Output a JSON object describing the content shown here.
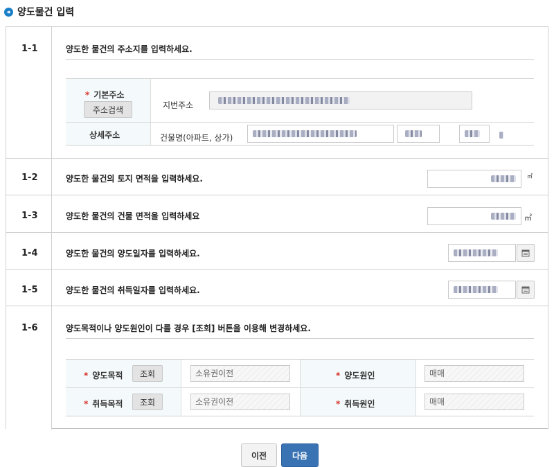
{
  "header": {
    "title": "양도물건 입력",
    "icon": "arrow-circle-icon",
    "accent": "#1a7fc7"
  },
  "sections": {
    "s1": {
      "num": "1-1",
      "question": "양도한 물건의 주소지를 입력하세요.",
      "basic_address_label": "기본주소",
      "address_search_button": "주소검색",
      "jibun_label": "지번주소",
      "detail_address_label": "상세주소",
      "building_label": "건물명(아파트, 상가)"
    },
    "s2": {
      "num": "1-2",
      "question": "양도한 물건의 토지 면적을 입력하세요.",
      "unit": "㎡"
    },
    "s3": {
      "num": "1-3",
      "question": "양도한 물건의 건물 면적을 입력하세요",
      "unit": "㎡"
    },
    "s4": {
      "num": "1-4",
      "question": "양도한 물건의 양도일자를 입력하세요."
    },
    "s5": {
      "num": "1-5",
      "question": "양도한 물건의 취득일자를 입력하세요."
    },
    "s6": {
      "num": "1-6",
      "question": "양도목적이나 양도원인이 다를 경우 [조회] 버튼을 이용해 변경하세요.",
      "transfer_purpose_label": "양도목적",
      "acquire_purpose_label": "취득목적",
      "lookup_button": "조회",
      "transfer_purpose_value": "소유권이전",
      "acquire_purpose_value": "소유권이전",
      "transfer_cause_label": "양도원인",
      "acquire_cause_label": "취득원인",
      "transfer_cause_value": "매매",
      "acquire_cause_value": "매매"
    }
  },
  "footer": {
    "prev_label": "이전",
    "next_label": "다음",
    "next_color": "#3a73b4"
  },
  "required_mark": "*"
}
